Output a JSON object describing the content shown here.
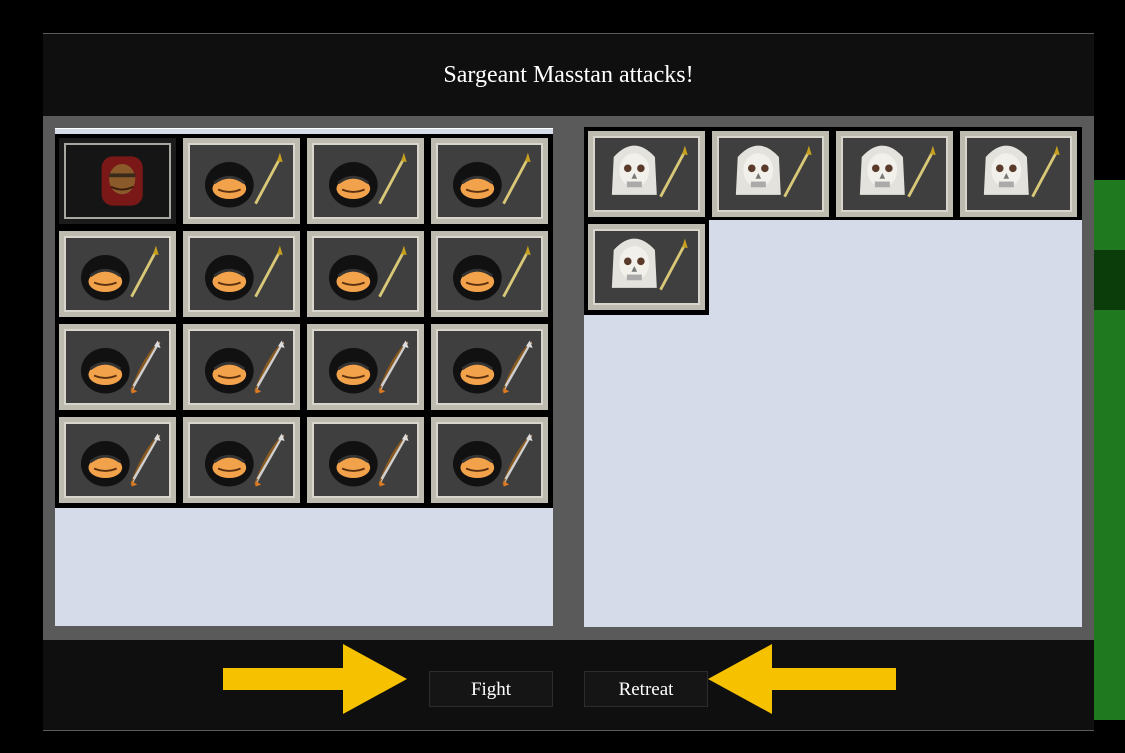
{
  "dialog": {
    "title": "Sargeant Masstan attacks!",
    "buttons": {
      "fight": "Fight",
      "retreat": "Retreat"
    }
  },
  "player_army": {
    "leader": {
      "name": "Sargeant Masstan",
      "icon": "red-armored-leader-portrait"
    },
    "units": [
      "spearman",
      "spearman",
      "spearman",
      "spearman",
      "spearman",
      "spearman",
      "spearman",
      "archer",
      "archer",
      "archer",
      "archer",
      "archer",
      "archer",
      "archer",
      "archer"
    ]
  },
  "enemy_army": {
    "units": [
      "skeleton-spearman",
      "skeleton-spearman",
      "skeleton-spearman",
      "skeleton-spearman",
      "skeleton-spearman"
    ]
  },
  "colors": {
    "panel_bg": "#d5dbe8",
    "frame": "#5a5a5a",
    "arrow": "#f6c200"
  }
}
